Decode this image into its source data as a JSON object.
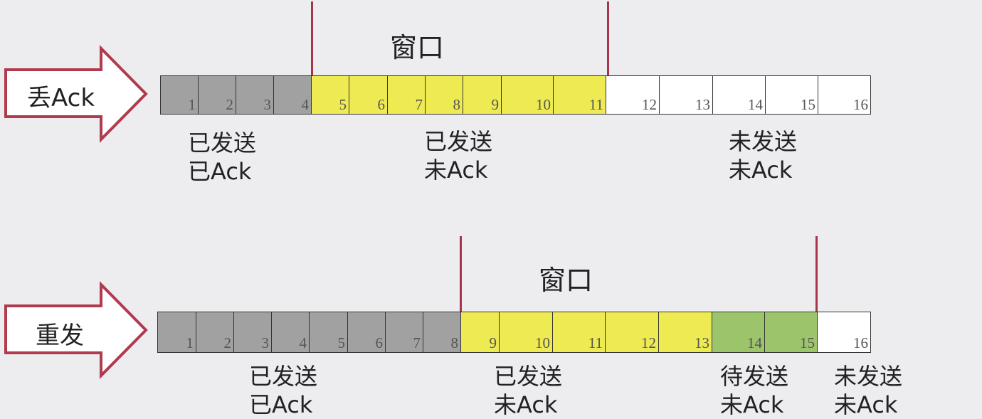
{
  "colors": {
    "sent_acked": "#a1a1a1",
    "sent_unacked": "#eeea52",
    "pending": "#9cc46a",
    "unsent": "#ffffff",
    "window_line": "#a8344a",
    "arrow": "#b03a4e"
  },
  "rows": [
    {
      "title": "丢Ack",
      "window_label": "窗口",
      "cells": [
        {
          "n": "1",
          "state": "sent_acked"
        },
        {
          "n": "2",
          "state": "sent_acked"
        },
        {
          "n": "3",
          "state": "sent_acked"
        },
        {
          "n": "4",
          "state": "sent_acked"
        },
        {
          "n": "5",
          "state": "sent_unacked"
        },
        {
          "n": "6",
          "state": "sent_unacked"
        },
        {
          "n": "7",
          "state": "sent_unacked"
        },
        {
          "n": "8",
          "state": "sent_unacked"
        },
        {
          "n": "9",
          "state": "sent_unacked"
        },
        {
          "n": "10",
          "state": "sent_unacked"
        },
        {
          "n": "11",
          "state": "sent_unacked"
        },
        {
          "n": "12",
          "state": "unsent"
        },
        {
          "n": "13",
          "state": "unsent"
        },
        {
          "n": "14",
          "state": "unsent"
        },
        {
          "n": "15",
          "state": "unsent"
        },
        {
          "n": "16",
          "state": "unsent"
        }
      ],
      "labels": [
        {
          "line1": "已发送",
          "line2": "已Ack"
        },
        {
          "line1": "已发送",
          "line2": "未Ack"
        },
        {
          "line1": "未发送",
          "line2": "未Ack"
        }
      ]
    },
    {
      "title": "重发",
      "window_label": "窗口",
      "cells": [
        {
          "n": "1",
          "state": "sent_acked"
        },
        {
          "n": "2",
          "state": "sent_acked"
        },
        {
          "n": "3",
          "state": "sent_acked"
        },
        {
          "n": "4",
          "state": "sent_acked"
        },
        {
          "n": "5",
          "state": "sent_acked"
        },
        {
          "n": "6",
          "state": "sent_acked"
        },
        {
          "n": "7",
          "state": "sent_acked"
        },
        {
          "n": "8",
          "state": "sent_acked"
        },
        {
          "n": "9",
          "state": "sent_unacked"
        },
        {
          "n": "10",
          "state": "sent_unacked"
        },
        {
          "n": "11",
          "state": "sent_unacked"
        },
        {
          "n": "12",
          "state": "sent_unacked"
        },
        {
          "n": "13",
          "state": "sent_unacked"
        },
        {
          "n": "14",
          "state": "pending"
        },
        {
          "n": "15",
          "state": "pending"
        },
        {
          "n": "16",
          "state": "unsent"
        }
      ],
      "labels": [
        {
          "line1": "已发送",
          "line2": "已Ack"
        },
        {
          "line1": "已发送",
          "line2": "未Ack"
        },
        {
          "line1": "待发送",
          "line2": "未Ack"
        },
        {
          "line1": "未发送",
          "line2": "未Ack"
        }
      ]
    }
  ]
}
